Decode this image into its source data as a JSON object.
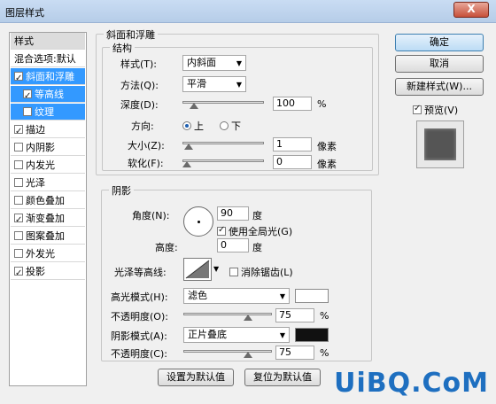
{
  "window": {
    "title": "图层样式",
    "close_glyph": "X"
  },
  "left_list": {
    "header": "样式",
    "items": [
      {
        "label": "混合选项:默认",
        "checkbox": false,
        "checked": false,
        "selected": false,
        "sub": false
      },
      {
        "label": "斜面和浮雕",
        "checkbox": true,
        "checked": true,
        "selected": true,
        "sub": false
      },
      {
        "label": "等高线",
        "checkbox": true,
        "checked": true,
        "selected": true,
        "sub": true
      },
      {
        "label": "纹理",
        "checkbox": true,
        "checked": false,
        "selected": true,
        "sub": true
      },
      {
        "label": "描边",
        "checkbox": true,
        "checked": true,
        "selected": false,
        "sub": false
      },
      {
        "label": "内阴影",
        "checkbox": true,
        "checked": false,
        "selected": false,
        "sub": false
      },
      {
        "label": "内发光",
        "checkbox": true,
        "checked": false,
        "selected": false,
        "sub": false
      },
      {
        "label": "光泽",
        "checkbox": true,
        "checked": false,
        "selected": false,
        "sub": false
      },
      {
        "label": "颜色叠加",
        "checkbox": true,
        "checked": false,
        "selected": false,
        "sub": false
      },
      {
        "label": "渐变叠加",
        "checkbox": true,
        "checked": true,
        "selected": false,
        "sub": false
      },
      {
        "label": "图案叠加",
        "checkbox": true,
        "checked": false,
        "selected": false,
        "sub": false
      },
      {
        "label": "外发光",
        "checkbox": true,
        "checked": false,
        "selected": false,
        "sub": false
      },
      {
        "label": "投影",
        "checkbox": true,
        "checked": true,
        "selected": false,
        "sub": false
      }
    ]
  },
  "bevel": {
    "group_title": "斜面和浮雕",
    "structure_title": "结构",
    "style_label": "样式(T):",
    "style_value": "内斜面",
    "technique_label": "方法(Q):",
    "technique_value": "平滑",
    "depth_label": "深度(D):",
    "depth_value": "100",
    "depth_unit": "%",
    "depth_slider": 0.1,
    "direction_label": "方向:",
    "direction_up": "上",
    "direction_down": "下",
    "size_label": "大小(Z):",
    "size_value": "1",
    "size_unit": "像素",
    "size_slider": 0.02,
    "soften_label": "软化(F):",
    "soften_value": "0",
    "soften_unit": "像素",
    "soften_slider": 0.0
  },
  "shading": {
    "title": "阴影",
    "angle_label": "角度(N):",
    "angle_value": "90",
    "angle_unit": "度",
    "global_light_label": "使用全局光(G)",
    "global_light_checked": true,
    "altitude_label": "高度:",
    "altitude_value": "0",
    "altitude_unit": "度",
    "gloss_contour_label": "光泽等高线:",
    "anti_alias_label": "消除锯齿(L)",
    "anti_alias_checked": false,
    "highlight_mode_label": "高光模式(H):",
    "highlight_mode_value": "滤色",
    "highlight_color": "#ffffff",
    "highlight_opacity_label": "不透明度(O):",
    "highlight_opacity_value": "75",
    "highlight_opacity_unit": "%",
    "highlight_opacity_slider": 0.75,
    "shadow_mode_label": "阴影模式(A):",
    "shadow_mode_value": "正片叠底",
    "shadow_color": "#111111",
    "shadow_opacity_label": "不透明度(C):",
    "shadow_opacity_value": "75",
    "shadow_opacity_unit": "%",
    "shadow_opacity_slider": 0.75
  },
  "bottom_buttons": {
    "make_default": "设置为默认值",
    "reset_default": "复位为默认值"
  },
  "right_panel": {
    "ok": "确定",
    "cancel": "取消",
    "new_style": "新建样式(W)...",
    "preview_label": "预览(V)",
    "preview_checked": true
  },
  "watermark": "UiBQ.CoM"
}
